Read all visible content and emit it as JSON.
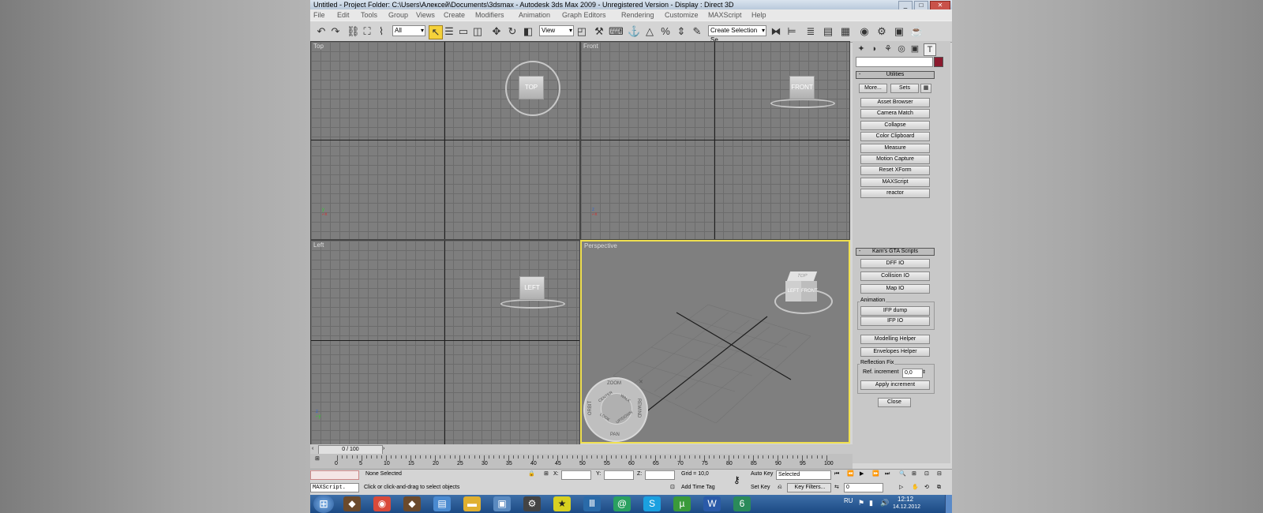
{
  "window": {
    "title": "Untitled     - Project Folder: C:\\Users\\Алексей\\Documents\\3dsmax     - Autodesk 3ds Max  2009   - Unregistered Version     - Display : Direct 3D"
  },
  "menu": [
    "File",
    "Edit",
    "Tools",
    "Group",
    "Views",
    "Create",
    "Modifiers",
    "Animation",
    "Graph Editors",
    "Rendering",
    "Customize",
    "MAXScript",
    "Help"
  ],
  "toolbar": {
    "selection_filter": "All",
    "reference_coord": "View",
    "named_selection_placeholder": "Create Selection Se"
  },
  "viewports": {
    "top": {
      "label": "Top",
      "cube": "TOP"
    },
    "front": {
      "label": "Front",
      "cube": "FRONT"
    },
    "left": {
      "label": "Left",
      "cube": "LEFT"
    },
    "perspective": {
      "label": "Perspective",
      "cube_top": "TOP",
      "cube_left": "LEFT",
      "cube_front": "FRONT"
    }
  },
  "steering_wheel": {
    "zoom": "ZOOM",
    "pan": "PAN",
    "orbit": "ORBIT",
    "rewind": "REWIND",
    "center": "CENTER",
    "walk": "WALK",
    "look": "LOOK",
    "updown": "UP/DOWN"
  },
  "command_panel": {
    "utilities": {
      "header": "Utilities",
      "more_label": "More...",
      "sets_label": "Sets",
      "buttons": [
        "Asset Browser",
        "Camera Match",
        "Collapse",
        "Color Clipboard",
        "Measure",
        "Motion Capture",
        "Reset XForm",
        "MAXScript",
        "reactor"
      ]
    },
    "gta": {
      "header": "Kam's GTA Scripts",
      "buttons": [
        "DFF IO",
        "Collision IO",
        "Map IO"
      ],
      "animation_group": "Animation",
      "animation_buttons": [
        "IFP dump",
        "IFP IO"
      ],
      "more_buttons": [
        "Modelling Helper",
        "Envelopes Helper"
      ],
      "reflection_group": "Reflection Fix",
      "ref_label": "Ref. increment",
      "ref_value": "0,0",
      "apply_label": "Apply increment",
      "close_label": "Close"
    }
  },
  "timeline": {
    "frame": "0 / 100",
    "ticks": [
      "0",
      "5",
      "10",
      "15",
      "20",
      "25",
      "30",
      "35",
      "40",
      "45",
      "50",
      "55",
      "60",
      "65",
      "70",
      "75",
      "80",
      "85",
      "90",
      "95",
      "100"
    ]
  },
  "status": {
    "maxscript_label": "MAXScript.",
    "selection": "None Selected",
    "prompt": "Click or click-and-drag to select objects",
    "x_label": "X:",
    "y_label": "Y:",
    "z_label": "Z:",
    "grid": "Grid = 10,0",
    "add_time_tag": "Add Time Tag",
    "auto_key": "Auto Key",
    "set_key": "Set Key",
    "selected_option": "Selected",
    "key_filters": "Key Filters...",
    "frame_field": "0"
  },
  "taskbar": {
    "lang": "RU",
    "time": "12:12",
    "date": "14.12.2012"
  },
  "colors": {
    "active_viewport_border": "#f0e050",
    "color_swatch": "#8b1a2e"
  }
}
